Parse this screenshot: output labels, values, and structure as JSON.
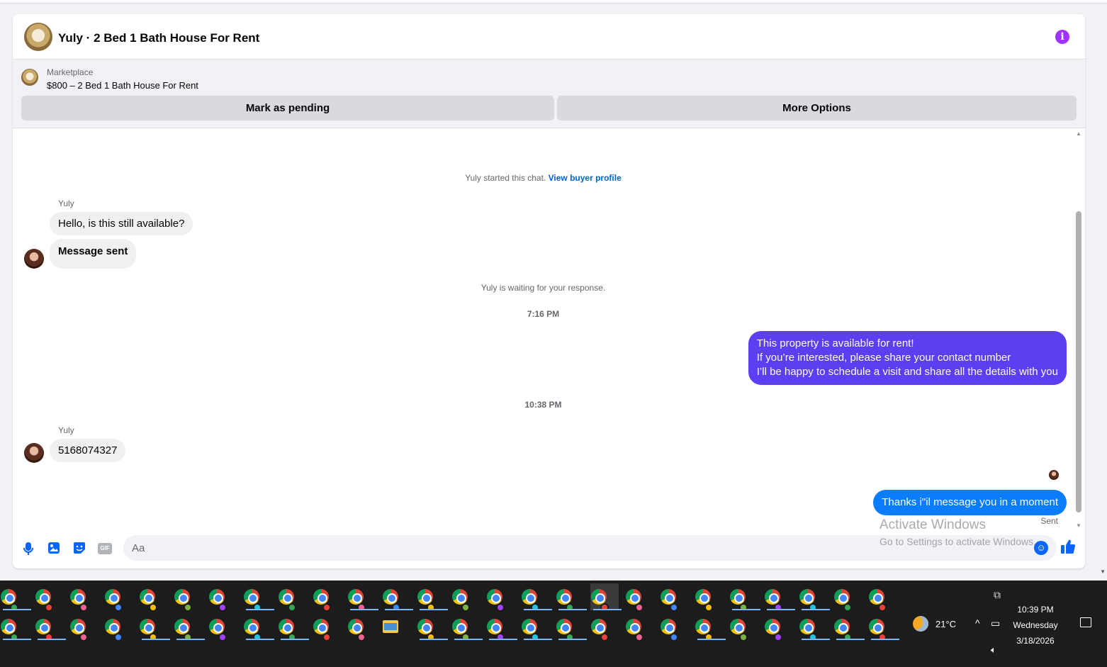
{
  "header": {
    "title": "Yuly · 2 Bed 1 Bath House For Rent"
  },
  "listing": {
    "label": "Marketplace",
    "title": "$800 – 2 Bed 1 Bath House For Rent",
    "mark_pending_label": "Mark as pending",
    "more_options_label": "More Options"
  },
  "messages": {
    "started_text": "Yuly started this chat.",
    "view_profile_link": "View buyer profile",
    "sender_name": "Yuly",
    "msg1": "Hello, is this still available?",
    "msg2": "Message sent",
    "waiting_text": "Yuly is waiting for your response.",
    "time1": "7:16 PM",
    "out1_line1": "This property is available for rent!",
    "out1_line2": "If you’re interested, please share your contact number",
    "out1_line3": "I’ll be happy to schedule a visit and share all the details with you",
    "time2": "10:38 PM",
    "msg3": "5168074327",
    "out2": "Thanks i\"il message you in a moment",
    "sent_status": "Sent"
  },
  "composer": {
    "placeholder": "Aa",
    "gif_label": "GIF"
  },
  "watermark": {
    "title": "Activate Windows",
    "subtitle": "Go to Settings to activate Windows."
  },
  "tray": {
    "temperature": "21°C",
    "time": "10:39 PM",
    "day": "Wednesday",
    "date": "3/18/2026"
  },
  "colors": {
    "outgoing_purple": "#5b3ff0",
    "outgoing_blue": "#0a7cff",
    "accent": "#0866ff",
    "info": "#a033ff"
  }
}
